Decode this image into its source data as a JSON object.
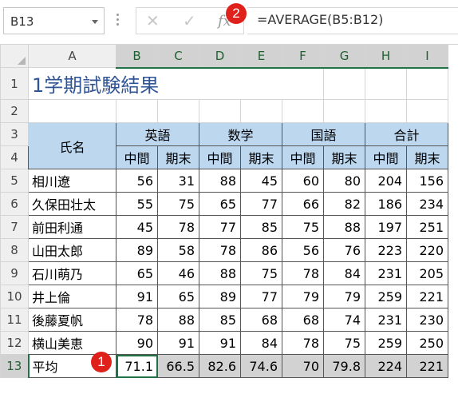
{
  "name_box": "B13",
  "formula": "=AVERAGE(B5:B12)",
  "fx_label": "fx",
  "cancel_glyph": "✕",
  "enter_glyph": "✓",
  "badges": [
    "1",
    "2"
  ],
  "columns": [
    "A",
    "B",
    "C",
    "D",
    "E",
    "F",
    "G",
    "H",
    "I"
  ],
  "rows": [
    "1",
    "2",
    "3",
    "4",
    "5",
    "6",
    "7",
    "8",
    "9",
    "10",
    "11",
    "12",
    "13"
  ],
  "sheet": {
    "title": "1学期試験結果",
    "header_name": "氏名",
    "subjects": [
      "英語",
      "数学",
      "国語",
      "合計"
    ],
    "terms": [
      "中間",
      "期末",
      "中間",
      "期末",
      "中間",
      "期末",
      "中間",
      "期末"
    ],
    "students": [
      {
        "name": "相川遼",
        "scores": [
          "56",
          "31",
          "88",
          "45",
          "60",
          "80",
          "204",
          "156"
        ]
      },
      {
        "name": "久保田壮太",
        "scores": [
          "55",
          "75",
          "65",
          "77",
          "66",
          "82",
          "186",
          "234"
        ]
      },
      {
        "name": "前田利通",
        "scores": [
          "45",
          "78",
          "77",
          "85",
          "75",
          "88",
          "197",
          "251"
        ]
      },
      {
        "name": "山田太郎",
        "scores": [
          "89",
          "58",
          "78",
          "86",
          "56",
          "76",
          "223",
          "220"
        ]
      },
      {
        "name": "石川萌乃",
        "scores": [
          "65",
          "46",
          "88",
          "75",
          "78",
          "84",
          "231",
          "205"
        ]
      },
      {
        "name": "井上倫",
        "scores": [
          "91",
          "65",
          "89",
          "77",
          "79",
          "79",
          "259",
          "221"
        ]
      },
      {
        "name": "後藤夏帆",
        "scores": [
          "78",
          "88",
          "85",
          "68",
          "68",
          "74",
          "231",
          "230"
        ]
      },
      {
        "name": "横山美恵",
        "scores": [
          "90",
          "91",
          "91",
          "84",
          "78",
          "75",
          "259",
          "250"
        ]
      }
    ],
    "average_label": "平均",
    "averages": [
      "71.1",
      "66.5",
      "82.6",
      "74.6",
      "70",
      "79.8",
      "224",
      "221"
    ]
  }
}
